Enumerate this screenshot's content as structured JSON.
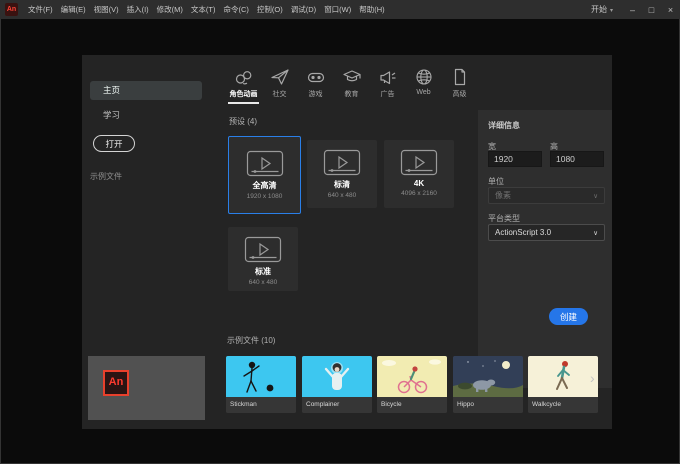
{
  "window": {
    "logo": "An",
    "menus": [
      "文件(F)",
      "编辑(E)",
      "视图(V)",
      "插入(I)",
      "修改(M)",
      "文本(T)",
      "命令(C)",
      "控制(O)",
      "调试(D)",
      "窗口(W)",
      "帮助(H)"
    ],
    "workspace_label": "开始",
    "workspace_caret": "▾",
    "controls": {
      "minimize": "–",
      "maximize": "□",
      "close": "×"
    }
  },
  "sidebar": {
    "home": "主页",
    "learn": "学习",
    "open_button": "打开",
    "footer": "示例文件"
  },
  "tabs": [
    {
      "label": "角色动画",
      "icon": "character-face-icon",
      "active": true
    },
    {
      "label": "社交",
      "icon": "paper-plane-icon",
      "active": false
    },
    {
      "label": "游戏",
      "icon": "game-controller-icon",
      "active": false
    },
    {
      "label": "教育",
      "icon": "graduation-cap-icon",
      "active": false
    },
    {
      "label": "广告",
      "icon": "megaphone-icon",
      "active": false
    },
    {
      "label": "Web",
      "icon": "globe-icon",
      "active": false
    },
    {
      "label": "高级",
      "icon": "document-icon",
      "active": false
    }
  ],
  "presets": {
    "header": "预设 (4)",
    "cards": [
      {
        "name": "全高清",
        "size": "1920 x 1080",
        "selected": true
      },
      {
        "name": "标清",
        "size": "640 x 480",
        "selected": false
      },
      {
        "name": "4K",
        "size": "4096 x 2160",
        "selected": false
      },
      {
        "name": "标准",
        "size": "640 x 480",
        "selected": false
      }
    ]
  },
  "details": {
    "header": "详细信息",
    "width_label": "宽",
    "width_value": "1920",
    "height_label": "高",
    "height_value": "1080",
    "units_label": "单位",
    "units_value": "像素",
    "units_chevron": "∨",
    "platform_label": "平台类型",
    "platform_value": "ActionScript 3.0",
    "platform_chevron": "∨",
    "create_button": "创建"
  },
  "samples": {
    "header": "示例文件 (10)",
    "items": [
      {
        "name": "Stickman"
      },
      {
        "name": "Complainer"
      },
      {
        "name": "Bicycle"
      },
      {
        "name": "Hippo"
      },
      {
        "name": "Walkcycle"
      }
    ],
    "more_arrow": "›"
  },
  "banner": {
    "logo_text": "An"
  },
  "colors": {
    "accent_blue": "#2576e9",
    "selection_border": "#2a7fe8",
    "logo_red": "#ff4437",
    "thumb_cyan": "#3dc7f0",
    "thumb_yellow": "#f2ecb2",
    "thumb_night": "#323f57",
    "thumb_cream": "#f6f1d8"
  }
}
